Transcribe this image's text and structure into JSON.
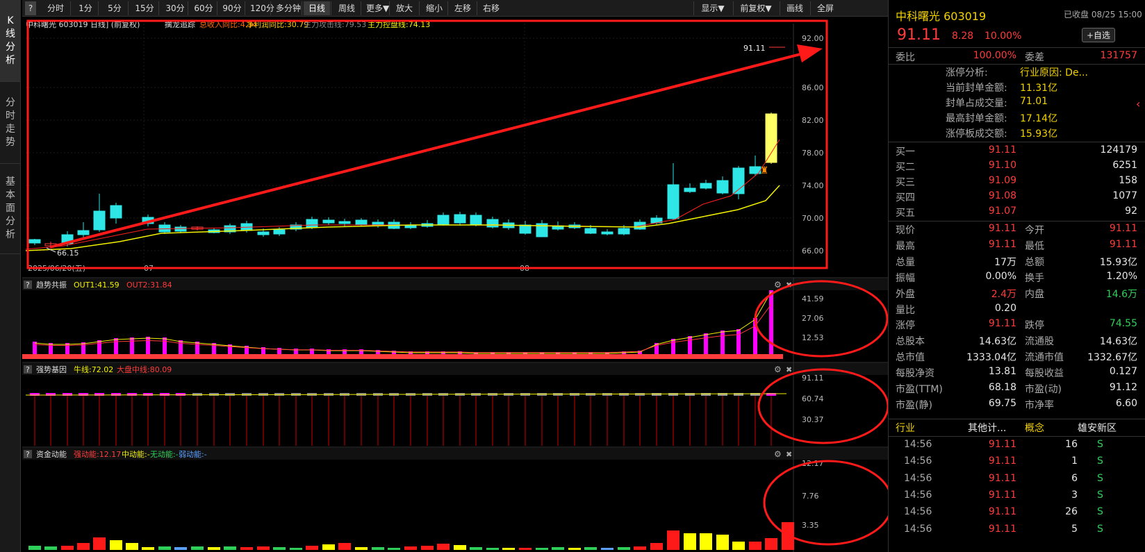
{
  "sidebar": {
    "tabs": [
      {
        "label": "K\n线\n分\n析",
        "active": true
      },
      {
        "label": "分\n时\n走\n势",
        "active": false
      },
      {
        "label": "基\n本\n面\n分\n析",
        "active": false
      }
    ]
  },
  "toolbar": {
    "help": "?",
    "items": [
      {
        "label": "分时"
      },
      {
        "label": "1分"
      },
      {
        "label": "5分"
      },
      {
        "label": "15分"
      },
      {
        "label": "30分"
      },
      {
        "label": "60分"
      },
      {
        "label": "90分"
      },
      {
        "label": "120分"
      },
      {
        "label": "多分钟"
      },
      {
        "label": "日线",
        "active": true
      },
      {
        "label": "周线"
      },
      {
        "label": "更多▼"
      },
      {
        "label": "放大"
      },
      {
        "label": "缩小"
      },
      {
        "label": "左移"
      },
      {
        "label": "右移"
      }
    ],
    "right_items": [
      {
        "label": "显示▼"
      },
      {
        "label": "前复权▼"
      },
      {
        "label": "画线"
      },
      {
        "label": "全屏"
      }
    ]
  },
  "main_chart": {
    "header": "中科曙光 603019 日线] (前复权)",
    "indicator_name": "擒龙追踪",
    "ind1": "总收入同比:4.34",
    "ind2": "净利润同比:30.79",
    "ind3": "主力攻击线:79.53",
    "ind4": "主力控盘线:74.13",
    "price_label": "91.11",
    "low_label": "66.15",
    "axis": [
      "92.00",
      "86.00",
      "82.00",
      "78.00",
      "74.00",
      "70.00",
      "66.00"
    ],
    "date_labels": [
      "2025/06/20(五)",
      "07",
      "08"
    ]
  },
  "panel2": {
    "name": "趋势共振",
    "out1": "OUT1:41.59",
    "out2": "OUT2:31.84",
    "axis": [
      "41.59",
      "27.06",
      "12.53"
    ]
  },
  "panel3": {
    "name": "强势基因",
    "l1": "牛线:72.02",
    "l2": "大盘中线:80.09",
    "axis": [
      "91.11",
      "60.74",
      "30.37"
    ]
  },
  "panel4": {
    "name": "资金动能",
    "l1": "强动能:12.17",
    "l2": "中动能:-",
    "l3": "无动能:-",
    "l4": "弱动能:-",
    "axis": [
      "12.17",
      "7.76",
      "3.35"
    ]
  },
  "quote": {
    "name": "中科曙光 603019",
    "status": "已收盘 08/25 15:00",
    "price": "91.11",
    "change": "8.28",
    "pct": "10.00%",
    "add_watch": "+自选",
    "webi_label": "委比",
    "webi": "100.00%",
    "weicha_label": "委差",
    "weicha": "131757",
    "limit_info": [
      {
        "k": "涨停分析:",
        "v": "行业原因: De..."
      },
      {
        "k": "当前封单金额:",
        "v": "11.31亿"
      },
      {
        "k": "封单占成交量:",
        "v": "71.01"
      },
      {
        "k": "最高封单金额:",
        "v": "17.14亿"
      },
      {
        "k": "涨停板成交额:",
        "v": "15.93亿"
      }
    ],
    "bids": [
      {
        "label": "买一",
        "price": "91.11",
        "vol": "124179"
      },
      {
        "label": "买二",
        "price": "91.10",
        "vol": "6251"
      },
      {
        "label": "买三",
        "price": "91.09",
        "vol": "158"
      },
      {
        "label": "买四",
        "price": "91.08",
        "vol": "1077"
      },
      {
        "label": "买五",
        "price": "91.07",
        "vol": "92"
      }
    ],
    "stats": [
      {
        "l": "现价",
        "lv": "91.11",
        "lc": "red",
        "r": "今开",
        "rv": "91.11",
        "rc": "red"
      },
      {
        "l": "最高",
        "lv": "91.11",
        "lc": "red",
        "r": "最低",
        "rv": "91.11",
        "rc": "red"
      },
      {
        "l": "总量",
        "lv": "17万",
        "lc": "white",
        "r": "总额",
        "rv": "15.93亿",
        "rc": "white"
      },
      {
        "l": "振幅",
        "lv": "0.00%",
        "lc": "white",
        "r": "换手",
        "rv": "1.20%",
        "rc": "white"
      },
      {
        "l": "外盘",
        "lv": "2.4万",
        "lc": "red",
        "r": "内盘",
        "rv": "14.6万",
        "rc": "green"
      },
      {
        "l": "量比",
        "lv": "0.20",
        "lc": "white",
        "r": "",
        "rv": "",
        "rc": "white"
      },
      {
        "l": "涨停",
        "lv": "91.11",
        "lc": "red",
        "r": "跌停",
        "rv": "74.55",
        "rc": "green"
      },
      {
        "l": "总股本",
        "lv": "14.63亿",
        "lc": "white",
        "r": "流通股",
        "rv": "14.63亿",
        "rc": "white"
      },
      {
        "l": "总市值",
        "lv": "1333.04亿",
        "lc": "white",
        "r": "流通市值",
        "rv": "1332.67亿",
        "rc": "white"
      },
      {
        "l": "每股净资",
        "lv": "13.81",
        "lc": "white",
        "r": "每股收益",
        "rv": "0.127",
        "rc": "white"
      },
      {
        "l": "市盈(TTM)",
        "lv": "68.18",
        "lc": "white",
        "r": "市盈(动)",
        "rv": "91.12",
        "rc": "white"
      },
      {
        "l": "市盈(静)",
        "lv": "69.75",
        "lc": "white",
        "r": "市净率",
        "rv": "6.60",
        "rc": "white"
      }
    ],
    "industry_label": "行业",
    "industry": "其他计...",
    "concept_label": "概念",
    "concept": "雄安新区",
    "trades": [
      {
        "t": "14:56",
        "p": "91.11",
        "v": "16",
        "s": "S"
      },
      {
        "t": "14:56",
        "p": "91.11",
        "v": "1",
        "s": "S"
      },
      {
        "t": "14:56",
        "p": "91.11",
        "v": "6",
        "s": "S"
      },
      {
        "t": "14:56",
        "p": "91.11",
        "v": "3",
        "s": "S"
      },
      {
        "t": "14:56",
        "p": "91.11",
        "v": "26",
        "s": "S"
      },
      {
        "t": "14:56",
        "p": "91.11",
        "v": "5",
        "s": "S"
      }
    ]
  },
  "colors": {
    "up": "#ff3c3c",
    "down": "#2ee6e6",
    "ma1": "#f2f200",
    "ma2": "#ff2020",
    "annotation": "#ff1a1a"
  }
}
